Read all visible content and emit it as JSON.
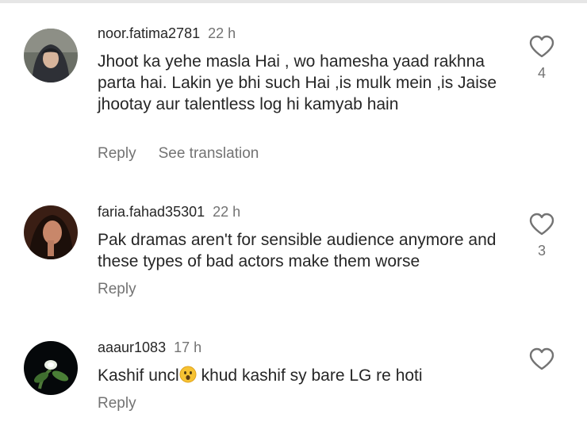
{
  "comments": [
    {
      "username": "noor.fatima2781",
      "time": "22 h",
      "text": "Jhoot ka yehe masla Hai , wo hamesha yaad rakhna parta hai. Lakin ye bhi such Hai ,is mulk mein ,is Jaise jhootay aur talentless log hi kamyab hain",
      "reply_label": "Reply",
      "translation_label": "See translation",
      "likes": "4",
      "avatar_icon": "user-avatar-hijab"
    },
    {
      "username": "faria.fahad35301",
      "time": "22 h",
      "text": "Pak dramas aren't for sensible audience anymore and these types of bad actors make them worse",
      "reply_label": "Reply",
      "likes": "3",
      "avatar_icon": "user-avatar-woman"
    },
    {
      "username": "aaaur1083",
      "time": "17 h",
      "text_before_emoji": "Kashif uncl",
      "emoji": "hushed-face-emoji",
      "text_after_emoji": " khud kashif sy bare LG re hoti",
      "reply_label": "Reply",
      "avatar_icon": "user-avatar-plant"
    }
  ],
  "colors": {
    "text": "#262626",
    "secondary": "#737373",
    "divider": "#e6e6e6"
  },
  "icons": {
    "like": "heart-outline-icon"
  }
}
